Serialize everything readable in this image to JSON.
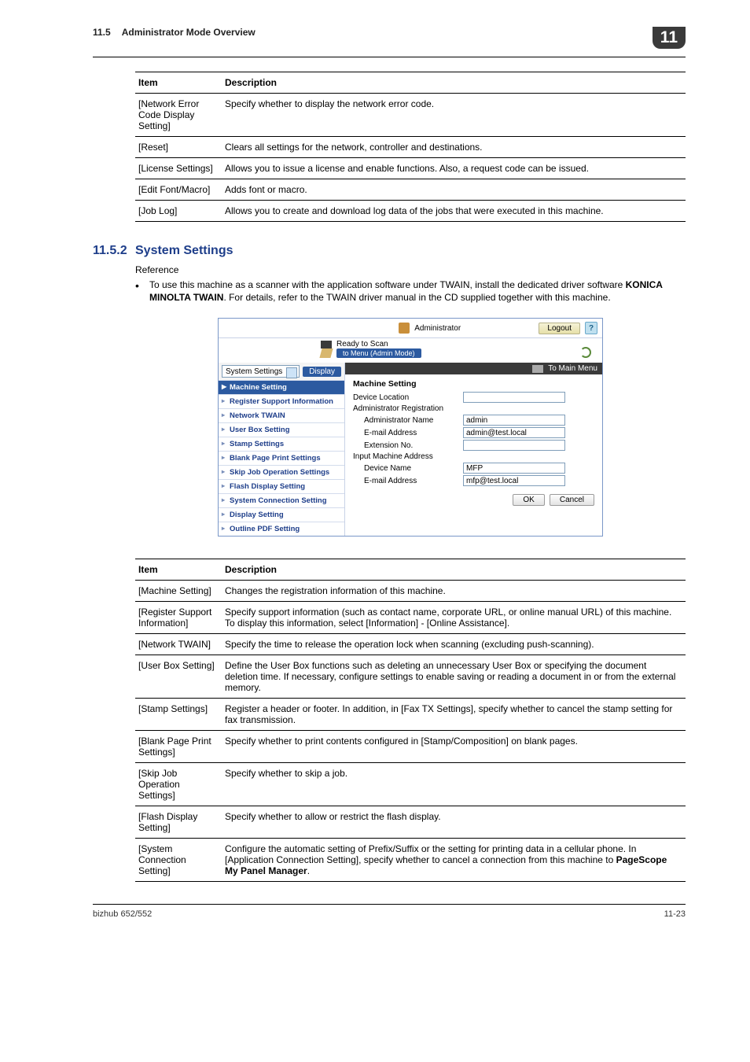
{
  "header": {
    "section_number": "11.5",
    "section_title": "Administrator Mode Overview",
    "chapter": "11"
  },
  "table1": {
    "headers": {
      "item": "Item",
      "desc": "Description"
    },
    "rows": [
      {
        "item": "[Network Error Code Display Setting]",
        "desc": "Specify whether to display the network error code."
      },
      {
        "item": "[Reset]",
        "desc": "Clears all settings for the network, controller and destinations."
      },
      {
        "item": "[License Settings]",
        "desc": "Allows you to issue a license and enable functions. Also, a request code can be issued."
      },
      {
        "item": "[Edit Font/Macro]",
        "desc": "Adds font or macro."
      },
      {
        "item": "[Job Log]",
        "desc": "Allows you to create and download log data of the jobs that were executed in this machine."
      }
    ]
  },
  "subheading": {
    "number": "11.5.2",
    "title": "System Settings"
  },
  "reference_label": "Reference",
  "bullet": {
    "pre": "To use this machine as a scanner with the application software under TWAIN, install the dedicated driver software ",
    "bold": "KONICA MINOLTA TWAIN",
    "post": ". For details, refer to the TWAIN driver manual in the CD supplied together with this machine."
  },
  "screenshot": {
    "administrator": "Administrator",
    "logout": "Logout",
    "help": "?",
    "ready": "Ready to Scan",
    "to_menu": "to Menu (Admin Mode)",
    "dropdown": "System Settings",
    "display_btn": "Display",
    "to_main_menu": "To Main Menu",
    "nav": [
      "Machine Setting",
      "Register Support Information",
      "Network TWAIN",
      "User Box Setting",
      "Stamp Settings",
      "Blank Page Print Settings",
      "Skip Job Operation Settings",
      "Flash Display Setting",
      "System Connection Setting",
      "Display Setting",
      "Outline PDF Setting"
    ],
    "form": {
      "title": "Machine Setting",
      "rows": [
        {
          "label": "Device Location",
          "value": "",
          "indent": false
        },
        {
          "label": "Administrator Registration",
          "value": null,
          "indent": false
        },
        {
          "label": "Administrator Name",
          "value": "admin",
          "indent": true
        },
        {
          "label": "E-mail Address",
          "value": "admin@test.local",
          "indent": true
        },
        {
          "label": "Extension No.",
          "value": "",
          "indent": true
        },
        {
          "label": "Input Machine Address",
          "value": null,
          "indent": false
        },
        {
          "label": "Device Name",
          "value": "MFP",
          "indent": true
        },
        {
          "label": "E-mail Address",
          "value": "mfp@test.local",
          "indent": true
        }
      ],
      "ok": "OK",
      "cancel": "Cancel"
    }
  },
  "table2": {
    "headers": {
      "item": "Item",
      "desc": "Description"
    },
    "rows": [
      {
        "item": "[Machine Setting]",
        "desc": "Changes the registration information of this machine."
      },
      {
        "item": "[Register Support Information]",
        "desc": "Specify support information (such as contact name, corporate URL, or online manual URL) of this machine. To display this information, select [Information] - [Online Assistance]."
      },
      {
        "item": "[Network TWAIN]",
        "desc": "Specify the time to release the operation lock when scanning (excluding push-scanning)."
      },
      {
        "item": "[User Box Setting]",
        "desc": "Define the User Box functions such as deleting an unnecessary User Box or specifying the document deletion time. If necessary, configure settings to enable saving or reading a document in or from the external memory."
      },
      {
        "item": "[Stamp Settings]",
        "desc": "Register a header or footer. In addition, in [Fax TX Settings], specify whether to cancel the stamp setting for fax transmission."
      },
      {
        "item": "[Blank Page Print Settings]",
        "desc": "Specify whether to print contents configured in [Stamp/Composition] on blank pages."
      },
      {
        "item": "[Skip Job Operation Settings]",
        "desc": "Specify whether to skip a job."
      },
      {
        "item": "[Flash Display Setting]",
        "desc": "Specify whether to allow or restrict the flash display."
      },
      {
        "item": "[System Connection Setting]",
        "desc_pre": "Configure the automatic setting of Prefix/Suffix or the setting for printing data in a cellular phone. In [Application Connection Setting], specify whether to cancel a connection from this machine to ",
        "desc_bold": "PageScope My Panel Manager",
        "desc_post": "."
      }
    ]
  },
  "footer": {
    "left": "bizhub 652/552",
    "right": "11-23"
  }
}
